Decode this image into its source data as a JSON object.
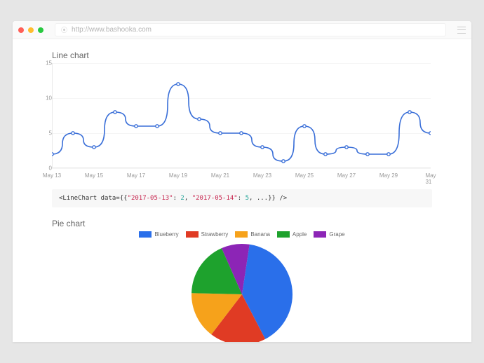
{
  "browser": {
    "url": "http://www.bashooka.com"
  },
  "line_section": {
    "title": "Line chart"
  },
  "code_snippet": {
    "open": "<LineChart data={{",
    "k1": "\"2017-05-13\"",
    "v1": "2",
    "k2": "\"2017-05-14\"",
    "v2": "5",
    "rest": ", ...}} />"
  },
  "pie_section": {
    "title": "Pie chart"
  },
  "chart_data": [
    {
      "type": "line",
      "title": "Line chart",
      "xlabel": "",
      "ylabel": "",
      "ylim": [
        0,
        15
      ],
      "yticks": [
        0,
        5,
        10,
        15
      ],
      "categories": [
        "May 13",
        "May 14",
        "May 15",
        "May 16",
        "May 17",
        "May 18",
        "May 19",
        "May 20",
        "May 21",
        "May 22",
        "May 23",
        "May 24",
        "May 25",
        "May 26",
        "May 27",
        "May 28",
        "May 29",
        "May 30",
        "May 31"
      ],
      "x_tick_labels": [
        "May 13",
        "May 15",
        "May 17",
        "May 19",
        "May 21",
        "May 23",
        "May 25",
        "May 27",
        "May 29",
        "May 31"
      ],
      "values": [
        2,
        5,
        3,
        8,
        6,
        6,
        12,
        7,
        5,
        5,
        3,
        1,
        6,
        2,
        3,
        2,
        2,
        8,
        5
      ],
      "line_color": "#3a6fd8"
    },
    {
      "type": "pie",
      "title": "Pie chart",
      "series": [
        {
          "name": "Blueberry",
          "value": 40,
          "color": "#2a6fea"
        },
        {
          "name": "Strawberry",
          "value": 18,
          "color": "#e03b24"
        },
        {
          "name": "Banana",
          "value": 15,
          "color": "#f6a21b"
        },
        {
          "name": "Apple",
          "value": 18,
          "color": "#1ea22d"
        },
        {
          "name": "Grape",
          "value": 9,
          "color": "#8c25b6"
        }
      ]
    }
  ]
}
